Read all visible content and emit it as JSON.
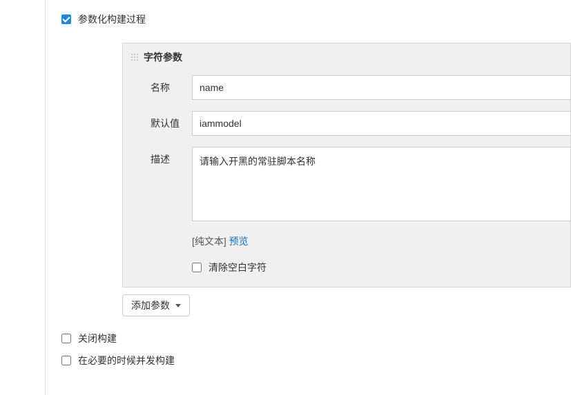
{
  "options": {
    "parameterized_label": "参数化构建过程",
    "close_build_label": "关闭构建",
    "concurrent_build_label": "在必要的时候并发构建"
  },
  "param_panel": {
    "title": "字符参数",
    "name_label": "名称",
    "name_value": "name",
    "default_label": "默认值",
    "default_value": "iammodel",
    "desc_label": "描述",
    "desc_value": "请输入开黑的常驻脚本名称",
    "hint_plain": "[纯文本]",
    "hint_preview": "预览",
    "trim_label": "清除空白字符"
  },
  "add_param_btn": "添加参数"
}
